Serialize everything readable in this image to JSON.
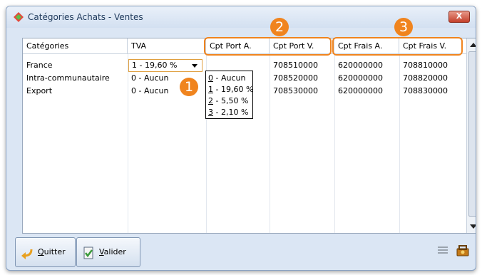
{
  "window": {
    "title": "Catégories Achats - Ventes",
    "close_label": "X"
  },
  "table": {
    "headers": [
      "Catégories",
      "TVA",
      "Cpt Port A.",
      "Cpt Port V.",
      "Cpt Frais A.",
      "Cpt Frais V."
    ],
    "rows": [
      {
        "categorie": "France",
        "tva": "1 - 19,60 %",
        "cpt_port_a": "",
        "cpt_port_v": "708510000",
        "cpt_frais_a": "620000000",
        "cpt_frais_v": "708810000"
      },
      {
        "categorie": "Intra-communautaire",
        "tva": "0 - Aucun",
        "cpt_port_a": "",
        "cpt_port_v": "708520000",
        "cpt_frais_a": "620000000",
        "cpt_frais_v": "708820000"
      },
      {
        "categorie": "Export",
        "tva": "0 - Aucun",
        "cpt_port_a": "",
        "cpt_port_v": "708530000",
        "cpt_frais_a": "620000000",
        "cpt_frais_v": "708830000"
      }
    ]
  },
  "tva_dropdown": {
    "selected": "1 - 19,60 %",
    "options": [
      {
        "key": "0",
        "rest": " - Aucun"
      },
      {
        "key": "1",
        "rest": " - 19,60 %"
      },
      {
        "key": "2",
        "rest": " - 5,50 %"
      },
      {
        "key": "3",
        "rest": " - 2,10 %"
      }
    ]
  },
  "callouts": [
    "1",
    "2",
    "3"
  ],
  "buttons": {
    "quit": {
      "key": "Q",
      "rest": "uitter"
    },
    "validate": {
      "key": "V",
      "rest": "alider"
    }
  },
  "icons": {
    "app": "diamond-app-icon",
    "quit": "back-arrow-icon",
    "validate": "check-document-icon",
    "list": "list-lines-icon",
    "tools": "toolbox-icon"
  },
  "colors": {
    "callout": "#f0841e",
    "close": "#c4402b"
  }
}
